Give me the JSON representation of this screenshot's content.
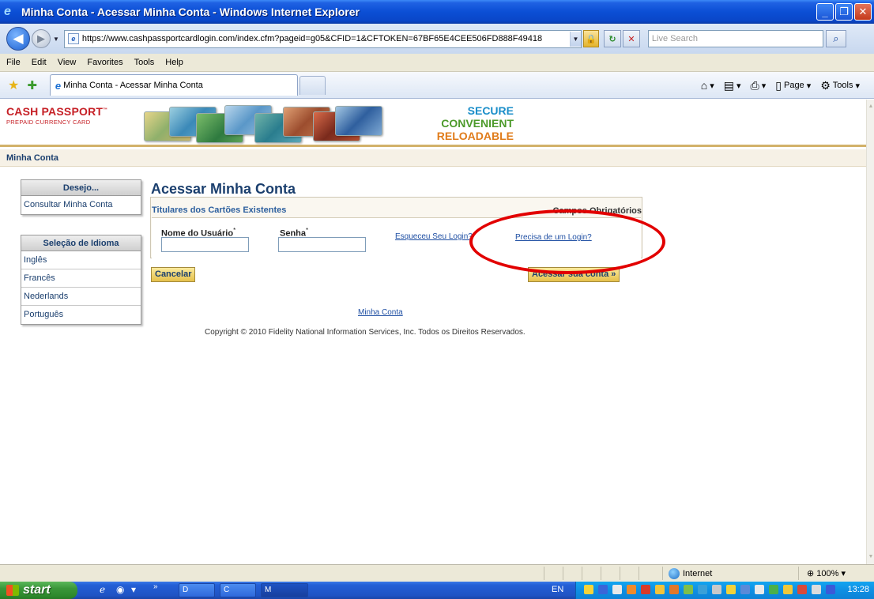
{
  "window": {
    "title": "Minha Conta - Acessar Minha Conta - Windows Internet Explorer",
    "min_icon": "minimize-icon",
    "max_icon": "restore-icon",
    "close_icon": "close-icon"
  },
  "navbar": {
    "url": "https://www.cashpassportcardlogin.com/index.cfm?pageid=g05&CFID=1&CFTOKEN=67BF65E4CEE506FD888F49418",
    "search_placeholder": "Live Search"
  },
  "menu": [
    "File",
    "Edit",
    "View",
    "Favorites",
    "Tools",
    "Help"
  ],
  "tab": {
    "title": "Minha Conta - Acessar Minha Conta"
  },
  "command_bar": {
    "page_label": "Page",
    "tools_label": "Tools"
  },
  "site": {
    "logo_main": "CASH PASSPORT",
    "logo_tm": "™",
    "logo_sub": "PREPAID CURRENCY CARD",
    "slogan": [
      "SECURE",
      "CONVENIENT",
      "RELOADABLE"
    ],
    "breadcrumb": "Minha Conta"
  },
  "sidebar": {
    "want_header": "Desejo...",
    "want_items": [
      "Consultar Minha Conta"
    ],
    "lang_header": "Seleção de Idioma",
    "lang_items": [
      "Inglês",
      "Francês",
      "Nederlands",
      "Português"
    ]
  },
  "login": {
    "title": "Acessar Minha Conta",
    "subtitle": "Titulares dos Cartões Existentes",
    "required_note": "Campos Obrigatórios",
    "username_label": "Nome do Usuário",
    "password_label": "Senha",
    "required_mark": "*",
    "forgot_link": "Esqueceu Seu Login?",
    "need_login_link": "Precisa de um Login?",
    "cancel_button": "Cancelar",
    "submit_button": "Acessar sua conta »"
  },
  "footer": {
    "link": "Minha Conta",
    "copyright": "Copyright © 2010 Fidelity National Information Services, Inc. Todos os Direitos Reservados."
  },
  "status": {
    "zone": "Internet",
    "zoom": "100%"
  },
  "taskbar": {
    "start": "start",
    "items": [
      "D",
      "C",
      "M"
    ],
    "lang": "EN",
    "clock": "13:28"
  },
  "colors": {
    "brand_red": "#c62026",
    "link_blue": "#1f4fa3",
    "heading_navy": "#1b3f6e",
    "annotation_red": "#e20000",
    "button_gold": "#e5c04c"
  }
}
